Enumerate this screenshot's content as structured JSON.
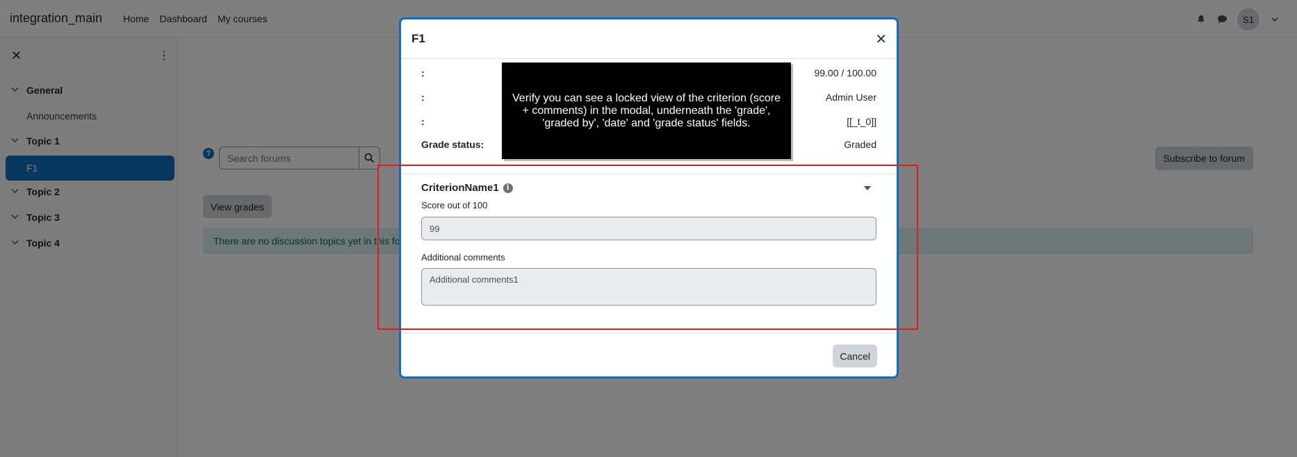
{
  "navbar": {
    "site_name": "integration_main",
    "links": [
      "Home",
      "Dashboard",
      "My courses"
    ],
    "user_initials": "S1"
  },
  "drawer": {
    "items": [
      {
        "label": "General",
        "type": "section"
      },
      {
        "label": "Announcements",
        "type": "sub"
      },
      {
        "label": "Topic 1",
        "type": "section"
      },
      {
        "label": "F1",
        "type": "active"
      },
      {
        "label": "Topic 2",
        "type": "section"
      },
      {
        "label": "Topic 3",
        "type": "section"
      },
      {
        "label": "Topic 4",
        "type": "section"
      }
    ]
  },
  "main": {
    "search_placeholder": "Search forums",
    "subscribe_label": "Subscribe to forum",
    "view_grades_label": "View grades",
    "alert_text": "There are no discussion topics yet in this forum"
  },
  "modal": {
    "title": "F1",
    "info": [
      {
        "label": ":",
        "value": "99.00 / 100.00"
      },
      {
        "label": ":",
        "value": "Admin User"
      },
      {
        "label": ":",
        "value": "[[_t_0]]"
      },
      {
        "label": "Grade status:",
        "value": "Graded"
      }
    ],
    "criterion_name": "CriterionName1",
    "score_label": "Score out of 100",
    "score_value": "99",
    "comments_label": "Additional comments",
    "comments_value": "Additional comments1",
    "cancel_label": "Cancel"
  },
  "note": {
    "text": "Verify you can see a locked view of the criterion (score + comments) in the modal, underneath the 'grade', 'graded by', 'date' and 'grade status' fields."
  },
  "colors": {
    "primary": "#0f6cbf",
    "highlight": "#e01b1b"
  }
}
